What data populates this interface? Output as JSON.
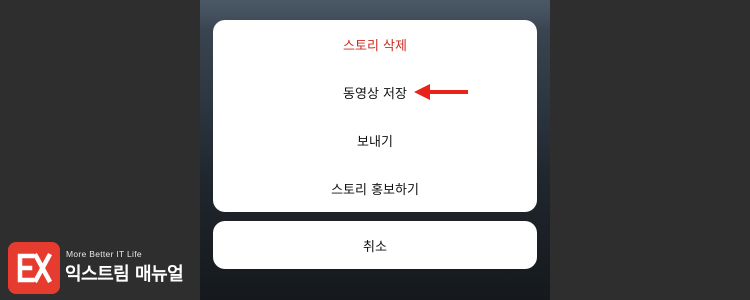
{
  "action_sheet": {
    "items": [
      {
        "label": "스토리 삭제"
      },
      {
        "label": "동영상 저장"
      },
      {
        "label": "보내기"
      },
      {
        "label": "스토리 홍보하기"
      }
    ],
    "cancel_label": "취소"
  },
  "watermark": {
    "tagline": "More Better IT Life",
    "brand": "익스트림 매뉴얼"
  },
  "colors": {
    "destructive": "#d12a1e",
    "annotation_arrow": "#e8241a",
    "logo": "#e63c2f"
  },
  "icons": [
    "annotation-arrow-icon",
    "brand-logo-icon"
  ]
}
